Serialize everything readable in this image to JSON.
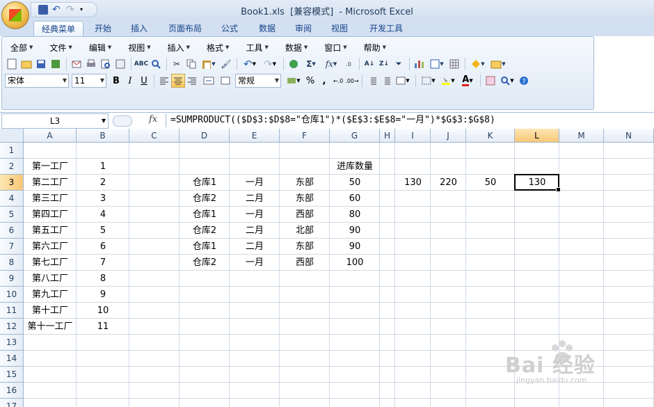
{
  "window": {
    "title_file": "Book1.xls",
    "title_mode": "[兼容模式]",
    "title_app": "- Microsoft Excel"
  },
  "tabs": [
    "经典菜单",
    "开始",
    "插入",
    "页面布局",
    "公式",
    "数据",
    "审阅",
    "视图",
    "开发工具"
  ],
  "active_tab": "经典菜单",
  "menus": [
    "全部",
    "文件",
    "编辑",
    "视图",
    "插入",
    "格式",
    "工具",
    "数据",
    "窗口",
    "帮助"
  ],
  "toolbar": {
    "font_name": "宋体",
    "font_size": "11",
    "number_format": "常规",
    "bold": "B",
    "italic": "I",
    "underline": "U"
  },
  "formula_bar": {
    "name_box": "L3",
    "fx": "fx",
    "formula": "=SUMPRODUCT(($D$3:$D$8=\"仓库1\")*($E$3:$E$8=\"一月\")*$G$3:$G$8)"
  },
  "columns": [
    "A",
    "B",
    "C",
    "D",
    "E",
    "F",
    "G",
    "H",
    "I",
    "J",
    "K",
    "L",
    "M",
    "N"
  ],
  "selected_column": "L",
  "rows": [
    "1",
    "2",
    "3",
    "4",
    "5",
    "6",
    "7",
    "8",
    "9",
    "10",
    "11",
    "12",
    "13",
    "14",
    "15",
    "16",
    "17"
  ],
  "selected_row": "3",
  "cells": {
    "A2": "第一工厂",
    "B2": "1",
    "G2": "进库数量",
    "A3": "第二工厂",
    "B3": "2",
    "D3": "仓库1",
    "E3": "一月",
    "F3": "东部",
    "G3": "50",
    "I3": "130",
    "J3": "220",
    "K3": "50",
    "L3": "130",
    "A4": "第三工厂",
    "B4": "3",
    "D4": "仓库2",
    "E4": "二月",
    "F4": "东部",
    "G4": "60",
    "A5": "第四工厂",
    "B5": "4",
    "D5": "仓库1",
    "E5": "一月",
    "F5": "西部",
    "G5": "80",
    "A6": "第五工厂",
    "B6": "5",
    "D6": "仓库2",
    "E6": "二月",
    "F6": "北部",
    "G6": "90",
    "A7": "第六工厂",
    "B7": "6",
    "D7": "仓库1",
    "E7": "二月",
    "F7": "东部",
    "G7": "90",
    "A8": "第七工厂",
    "B8": "7",
    "D8": "仓库2",
    "E8": "一月",
    "F8": "西部",
    "G8": "100",
    "A9": "第八工厂",
    "B9": "8",
    "A10": "第九工厂",
    "B10": "9",
    "A11": "第十工厂",
    "B11": "10",
    "A12": "第十一工厂",
    "B12": "11"
  },
  "watermark": {
    "main": "Bai 经验",
    "sub": "jingyan.baidu.com"
  }
}
